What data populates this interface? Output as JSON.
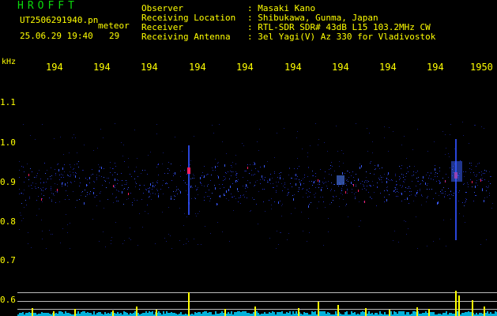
{
  "header": {
    "logo": "HROFFT",
    "filename": "UT2506291940.pn",
    "file_suffix": "meteor",
    "datetime": "25.06.29 19:40",
    "seconds": "29"
  },
  "info": [
    {
      "label": "Observer",
      "value": ": Masaki Kano"
    },
    {
      "label": "Receiving Location",
      "value": ": Shibukawa, Gunma, Japan"
    },
    {
      "label": "Receiver",
      "value": ": RTL-SDR SDR# 43dB L15 103.2MHz CW"
    },
    {
      "label": "Receiving Antenna",
      "value": ": 3el Yagi(V) Az 330 for Vladivostok"
    }
  ],
  "axis": {
    "unit": "kHz",
    "y_ticks": [
      "1.1",
      "1.0",
      "0.9",
      "0.8",
      "0.7",
      "0.6"
    ],
    "x_ticks": [
      "194",
      "194",
      "194",
      "194",
      "194",
      "194",
      "194",
      "194",
      "194",
      "1950"
    ]
  },
  "colors": {
    "text": "#ffff00",
    "logo": "#0bd90b",
    "background": "#000000",
    "signal_faint": "#2a3cff",
    "signal_strong": "#ff2060",
    "profile": "#ffff00",
    "noise": "#00d0ff"
  }
}
